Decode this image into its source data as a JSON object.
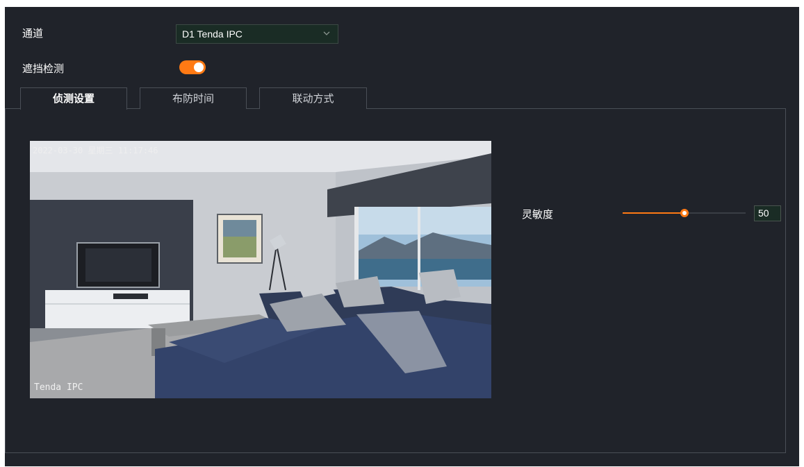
{
  "channel": {
    "label": "通道",
    "selected": "D1 Tenda IPC"
  },
  "occlusion": {
    "label": "遮挡检测",
    "enabled": true
  },
  "tabs": [
    {
      "label": "侦测设置",
      "active": true
    },
    {
      "label": "布防时间",
      "active": false
    },
    {
      "label": "联动方式",
      "active": false
    }
  ],
  "video": {
    "timestamp": "2022-03-30 星期三 11:17:46",
    "watermark": "Tenda IPC"
  },
  "sensitivity": {
    "label": "灵敏度",
    "value": "50",
    "fraction": 0.5
  },
  "colors": {
    "accent": "#ff7a14",
    "background": "#20232a",
    "border": "#4a4f57"
  }
}
